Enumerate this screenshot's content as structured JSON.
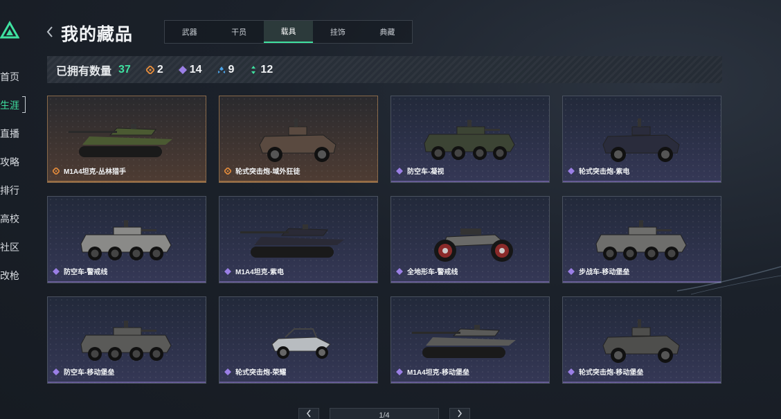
{
  "nav": {
    "items": [
      {
        "label": "首页",
        "active": false
      },
      {
        "label": "生涯",
        "active": true
      },
      {
        "label": "直播",
        "active": false
      },
      {
        "label": "攻略",
        "active": false
      },
      {
        "label": "排行",
        "active": false
      },
      {
        "label": "高校",
        "active": false
      },
      {
        "label": "社区",
        "active": false
      },
      {
        "label": "改枪",
        "active": false
      }
    ]
  },
  "header": {
    "back_icon": "chevron-left-icon",
    "title": "我的藏品",
    "tabs": [
      {
        "label": "武器",
        "active": false
      },
      {
        "label": "干员",
        "active": false
      },
      {
        "label": "载具",
        "active": true
      },
      {
        "label": "挂饰",
        "active": false
      },
      {
        "label": "典藏",
        "active": false
      }
    ]
  },
  "stats": {
    "label": "已拥有数量",
    "total": "37",
    "counts": [
      {
        "rarity": "orange",
        "color": "#e08a3c",
        "value": "2"
      },
      {
        "rarity": "purple",
        "color": "#9b7fe6",
        "value": "14"
      },
      {
        "rarity": "blue",
        "color": "#4aa3e8",
        "value": "9"
      },
      {
        "rarity": "green",
        "color": "#3fe1a0",
        "value": "12"
      }
    ]
  },
  "colors": {
    "accent": "#3fe1a0",
    "orange": "#e08a3c",
    "purple": "#9b7fe6",
    "blue": "#4aa3e8"
  },
  "vehicles": [
    {
      "name": "M1A4坦克-丛林猎手",
      "rarity": "orange",
      "kind": "tank",
      "paint": "#4b5a32"
    },
    {
      "name": "轮式突击炮-域外狂徒",
      "rarity": "orange",
      "kind": "apc4",
      "paint": "#5a4a40"
    },
    {
      "name": "防空车-凝视",
      "rarity": "purple",
      "kind": "apc8",
      "paint": "#3c4434"
    },
    {
      "name": "轮式突击炮-紫电",
      "rarity": "purple",
      "kind": "apc4",
      "paint": "#2a2c3c"
    },
    {
      "name": "防空车-警戒线",
      "rarity": "purple",
      "kind": "apc8",
      "paint": "#8a8a88"
    },
    {
      "name": "M1A4坦克-紫电",
      "rarity": "purple",
      "kind": "tank",
      "paint": "#2a2a36"
    },
    {
      "name": "全地形车-警戒线",
      "rarity": "purple",
      "kind": "atv",
      "paint": "#6a6a68"
    },
    {
      "name": "步战车-移动堡垒",
      "rarity": "purple",
      "kind": "apc8",
      "paint": "#6e6e6c"
    },
    {
      "name": "防空车-移动堡垒",
      "rarity": "purple",
      "kind": "apc8",
      "paint": "#5a5a58"
    },
    {
      "name": "轮式突击炮-荣耀",
      "rarity": "purple",
      "kind": "buggy",
      "paint": "#b8bcc0"
    },
    {
      "name": "M1A4坦克-移动堡垒",
      "rarity": "purple",
      "kind": "tank",
      "paint": "#5a5a58"
    },
    {
      "name": "轮式突击炮-移动堡垒",
      "rarity": "purple",
      "kind": "apc4",
      "paint": "#4e4e4c"
    }
  ],
  "pager": {
    "prev_icon": "chevron-left-icon",
    "next_icon": "chevron-right-icon",
    "text": "1/4"
  }
}
